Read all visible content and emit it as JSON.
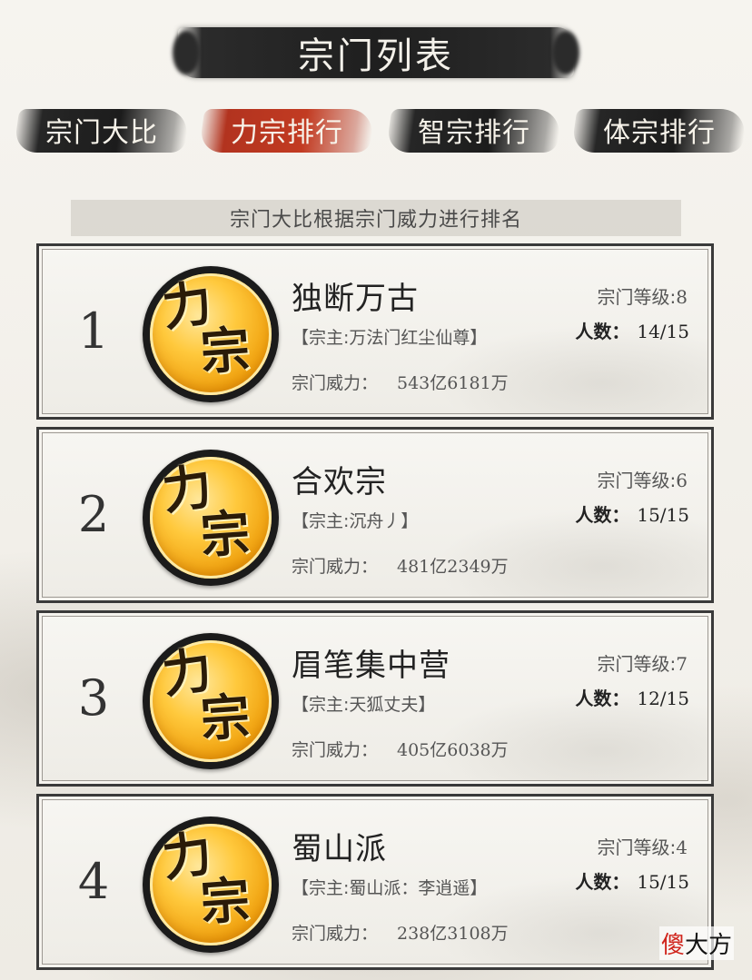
{
  "header": {
    "title": "宗门列表"
  },
  "tabs": [
    {
      "label": "宗门大比",
      "active": false
    },
    {
      "label": "力宗排行",
      "active": true
    },
    {
      "label": "智宗排行",
      "active": false
    },
    {
      "label": "体宗排行",
      "active": false
    }
  ],
  "subtitle": "宗门大比根据宗门威力进行排名",
  "emblem": {
    "char1": "力",
    "char2": "宗"
  },
  "labels": {
    "level": "宗门等级:",
    "members": "人数：",
    "power": "宗门威力："
  },
  "sects": [
    {
      "rank": "1",
      "name": "独断万古",
      "leader": "【宗主:万法门红尘仙尊】",
      "level": "8",
      "members": "14/15",
      "power": "543亿6181万"
    },
    {
      "rank": "2",
      "name": "合欢宗",
      "leader": "【宗主:沉舟丿】",
      "level": "6",
      "members": "15/15",
      "power": "481亿2349万"
    },
    {
      "rank": "3",
      "name": "眉笔集中营",
      "leader": "【宗主:天狐丈夫】",
      "level": "7",
      "members": "12/15",
      "power": "405亿6038万"
    },
    {
      "rank": "4",
      "name": "蜀山派",
      "leader": "【宗主:蜀山派：李逍遥】",
      "level": "4",
      "members": "15/15",
      "power": "238亿3108万"
    }
  ],
  "watermark": {
    "part1": "傻",
    "part2": "大方"
  },
  "colors": {
    "active_tab": "#c23b22",
    "ink": "#1f1f1f",
    "gold": "#f0a10e"
  }
}
